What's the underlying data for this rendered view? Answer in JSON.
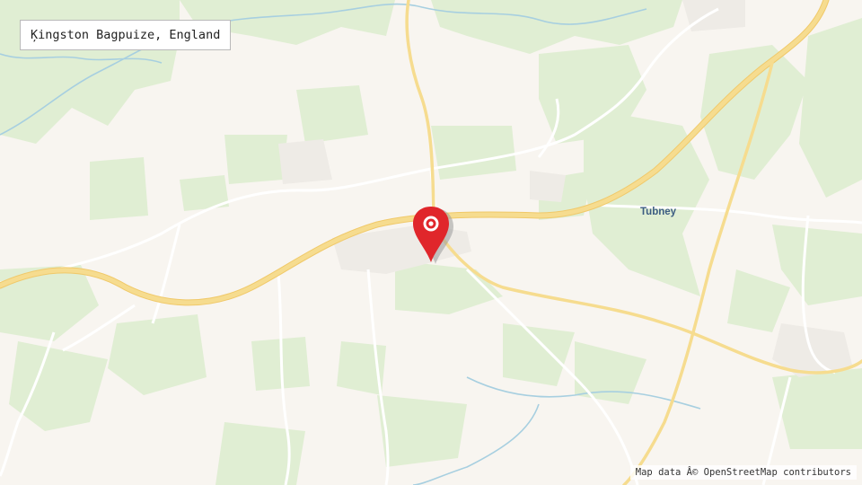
{
  "map": {
    "title": "Ķingston Bagpuize, England",
    "places": [
      {
        "name": "Tubney"
      }
    ],
    "attribution": "Map data Â© OpenStreetMap contributors",
    "marker": {
      "icon": "map-pin-icon",
      "color": "#e0262b"
    },
    "colors": {
      "land": "#f8f5f0",
      "woodland": "#e0eed3",
      "river": "#a7cfe0",
      "major_road": "#f6dc8f",
      "minor_road": "#ffffff",
      "built_up": "#eeebe6"
    }
  }
}
